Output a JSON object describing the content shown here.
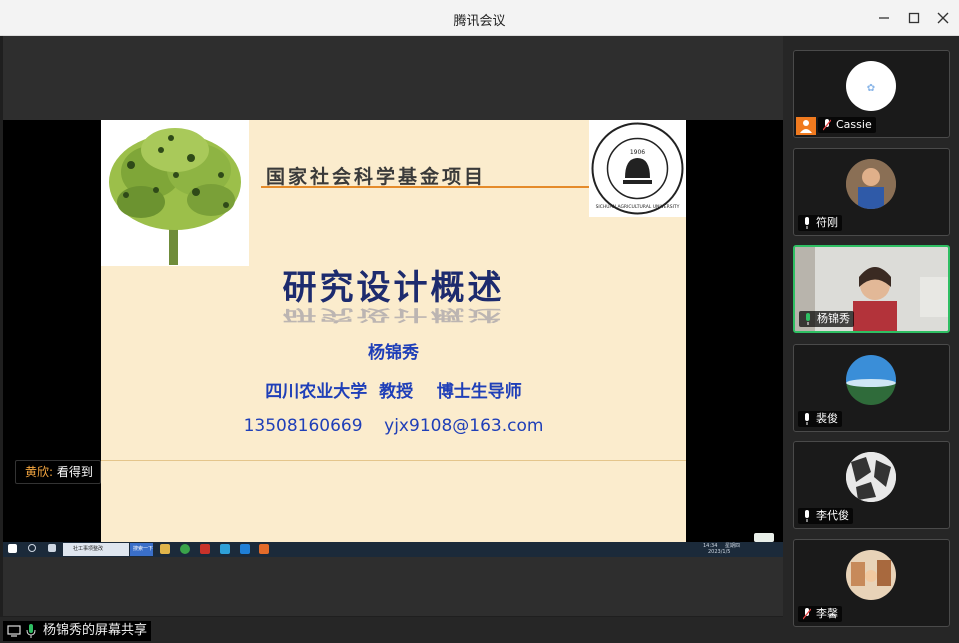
{
  "window": {
    "title": "腾讯会议"
  },
  "slide": {
    "heading": "国家社会科学基金项目",
    "title": "研究设计概述",
    "presenter": "杨锦秀",
    "university_line": "四川农业大学  教授    博士生导师",
    "contact_line": "13508160669    yjx9108@163.com",
    "logo_year": "1906",
    "logo_text": "SICHUAN AGRICULTURAL UNIVERSITY"
  },
  "chat": {
    "sender": "黄欣:",
    "message": "看得到"
  },
  "share_label": "杨锦秀的屏幕共享",
  "participants": [
    {
      "name": "Cassie",
      "mic": "muted",
      "active": false
    },
    {
      "name": "符刚",
      "mic": "on",
      "active": false
    },
    {
      "name": "杨锦秀",
      "mic": "speaking",
      "active": true
    },
    {
      "name": "裴俊",
      "mic": "on",
      "active": false
    },
    {
      "name": "李代俊",
      "mic": "on",
      "active": false
    },
    {
      "name": "李馨",
      "mic": "muted",
      "active": false
    }
  ],
  "taskbar": {
    "task1": "社工事项整改",
    "task2": "搜索一下",
    "clock_time": "14:34",
    "clock_date": "2023/1/5",
    "clock_weekday": "星期四"
  },
  "colors": {
    "active_border": "#2fbf63",
    "slide_bg": "#fbeccd",
    "slide_text": "#1f3fb8",
    "chat_name": "#f4a640"
  }
}
